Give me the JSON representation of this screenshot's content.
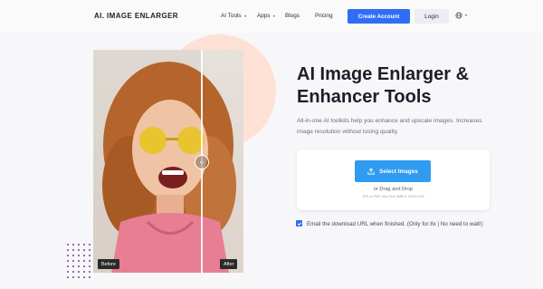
{
  "header": {
    "logo": "AI. IMAGE ENLARGER",
    "nav": [
      {
        "label": "AI Tools",
        "dropdown": true
      },
      {
        "label": "Apps",
        "dropdown": true
      },
      {
        "label": "Blogs",
        "dropdown": false
      },
      {
        "label": "Pricing",
        "dropdown": false
      }
    ],
    "create_account": "Create Account",
    "login": "Login",
    "language_icon": "globe-icon"
  },
  "hero": {
    "title": "AI Image Enlarger & Enhancer Tools",
    "subtitle": "All-in-one AI toolkits help you enhance and upscale images. Increases image resolution without losing quality.",
    "compare": {
      "before": "Before",
      "after": "After"
    }
  },
  "upload": {
    "select_label": "Select Images",
    "drag_text": "or Drag and Drop",
    "hint": "JPG or PNG. Max Size 5MB or 1200×1200",
    "upload_icon": "upload-icon"
  },
  "email_option": {
    "checked": true,
    "label": "Email the download URL when finished. (Only for 8x | No need to wait!)"
  },
  "colors": {
    "primary": "#2f6df6",
    "select_button": "#2f9bf1",
    "accent_circle": "#fde1d5",
    "dots": "#7a3fa0"
  }
}
